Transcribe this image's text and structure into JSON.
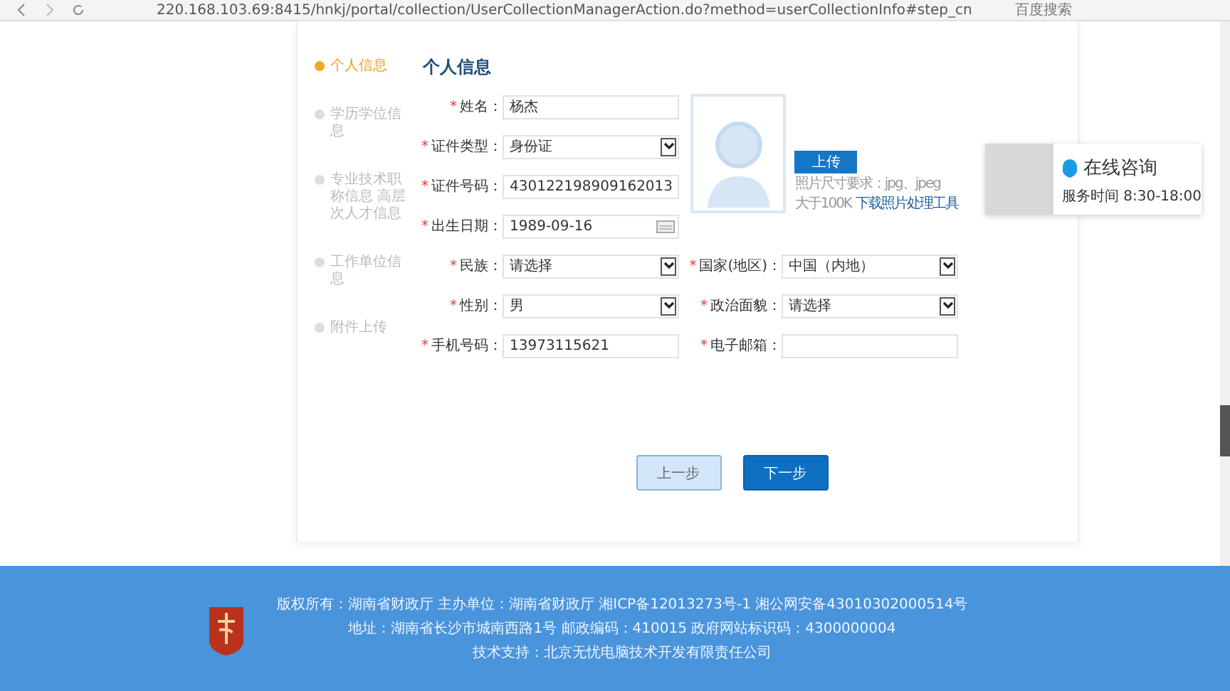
{
  "browser": {
    "url": "220.168.103.69:8415/hnkj/portal/collection/UserCollectionManagerAction.do?method=userCollectionInfo#step_cn",
    "search": "百度搜索"
  },
  "steps": [
    {
      "label": "个人信息",
      "selected": true
    },
    {
      "label": "学历学位信息",
      "selected": false
    },
    {
      "label": "专业技术职称信息 高层次人才信息",
      "selected": false
    },
    {
      "label": "工作单位信息",
      "selected": false
    },
    {
      "label": "附件上传",
      "selected": false
    }
  ],
  "section_title": "个人信息",
  "fields_left": [
    {
      "label": "姓名：",
      "kind": "text",
      "value": "杨杰",
      "mark": "*"
    },
    {
      "label": "证件类型：",
      "kind": "select",
      "value": "身份证",
      "mark": "*"
    },
    {
      "label": "证件号码：",
      "kind": "text",
      "value": "430122198909162013",
      "mark": "*"
    },
    {
      "label": "出生日期：",
      "kind": "date",
      "value": "1989-09-16",
      "mark": "*"
    },
    {
      "label": "民族：",
      "kind": "select",
      "value": "请选择",
      "mark": "*"
    },
    {
      "label": "性别：",
      "kind": "select",
      "value": "男",
      "mark": "*"
    },
    {
      "label": "手机号码：",
      "kind": "text",
      "value": "13973115621",
      "mark": "*"
    }
  ],
  "fields_right": [
    {
      "label": "国家(地区)：",
      "kind": "select",
      "value": "中国（内地）",
      "mark": "*"
    },
    {
      "label": "政治面貌：",
      "kind": "select",
      "value": "请选择",
      "mark": "*"
    },
    {
      "label": "电子邮箱：",
      "kind": "text",
      "mark": "*"
    }
  ],
  "photo": {
    "upload_button": "上传",
    "hint": "照片尺寸要求：jpg、jpeg",
    "hint_2": "大于100K",
    "tool_link": "下载照片处理工具"
  },
  "chat": {
    "title": "在线咨询",
    "hours": "服务时间 8:30-18:00"
  },
  "buttons": [
    {
      "label": "上一步",
      "kind": "secondary"
    },
    {
      "label": "下一步",
      "kind": "primary"
    }
  ],
  "footer": {
    "lines": [
      "版权所有：湖南省财政厅 主办单位：湖南省财政厅 湘ICP备12013273号-1 湘公网安备43010302000514号",
      "地址：湖南省长沙市城南西路1号 邮政编码：410015 政府网站标识码：4300000004",
      "技术支持：北京无忧电脑技术开发有限责任公司"
    ]
  }
}
